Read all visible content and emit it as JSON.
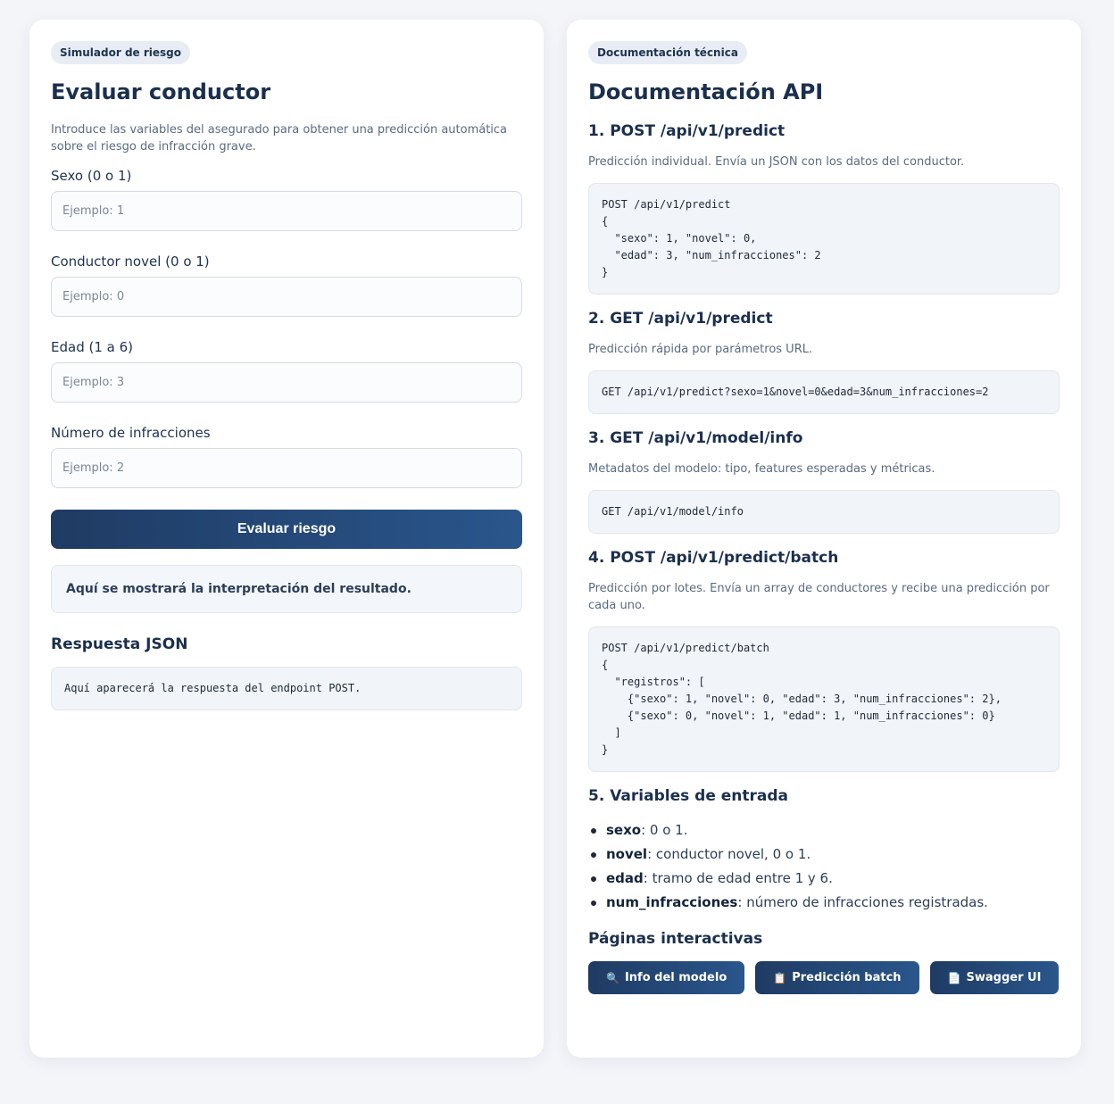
{
  "left": {
    "badge": "Simulador de riesgo",
    "title": "Evaluar conductor",
    "intro": "Introduce las variables del asegurado para obtener una predicción automática sobre el riesgo de infracción grave.",
    "fields": [
      {
        "label": "Sexo (0 o 1)",
        "placeholder": "Ejemplo: 1",
        "value": ""
      },
      {
        "label": "Conductor novel (0 o 1)",
        "placeholder": "Ejemplo: 0",
        "value": ""
      },
      {
        "label": "Edad (1 a 6)",
        "placeholder": "Ejemplo: 3",
        "value": ""
      },
      {
        "label": "Número de infracciones",
        "placeholder": "Ejemplo: 2",
        "value": ""
      }
    ],
    "submit_label": "Evaluar riesgo",
    "result_text": "Aquí se mostrará la interpretación del resultado.",
    "json_title": "Respuesta JSON",
    "json_placeholder": "Aquí aparecerá la respuesta del endpoint POST."
  },
  "right": {
    "badge": "Documentación técnica",
    "title": "Documentación API",
    "sections": [
      {
        "title": "1. POST /api/v1/predict",
        "desc": "Predicción individual. Envía un JSON con los datos del conductor.",
        "code": "POST /api/v1/predict\n{\n  \"sexo\": 1, \"novel\": 0,\n  \"edad\": 3, \"num_infracciones\": 2\n}"
      },
      {
        "title": "2. GET /api/v1/predict",
        "desc": "Predicción rápida por parámetros URL.",
        "code": "GET /api/v1/predict?sexo=1&novel=0&edad=3&num_infracciones=2"
      },
      {
        "title": "3. GET /api/v1/model/info",
        "desc": "Metadatos del modelo: tipo, features esperadas y métricas.",
        "code": "GET /api/v1/model/info"
      },
      {
        "title": "4. POST /api/v1/predict/batch",
        "desc": "Predicción por lotes. Envía un array de conductores y recibe una predicción por cada uno.",
        "code": "POST /api/v1/predict/batch\n{\n  \"registros\": [\n    {\"sexo\": 1, \"novel\": 0, \"edad\": 3, \"num_infracciones\": 2},\n    {\"sexo\": 0, \"novel\": 1, \"edad\": 1, \"num_infracciones\": 0}\n  ]\n}"
      }
    ],
    "vars_title": "5. Variables de entrada",
    "vars": [
      {
        "name": "sexo",
        "desc": ": 0 o 1."
      },
      {
        "name": "novel",
        "desc": ": conductor novel, 0 o 1."
      },
      {
        "name": "edad",
        "desc": ": tramo de edad entre 1 y 6."
      },
      {
        "name": "num_infracciones",
        "desc": ": número de infracciones registradas."
      }
    ],
    "pages_title": "Páginas interactivas",
    "pages": [
      {
        "icon": "magnifier-icon",
        "glyph": "🔍",
        "label": "Info del modelo"
      },
      {
        "icon": "clipboard-icon",
        "glyph": "📋",
        "label": "Predicción batch"
      },
      {
        "icon": "document-icon",
        "glyph": "📄",
        "label": "Swagger UI"
      }
    ]
  },
  "colors": {
    "background": "#f3f5f9",
    "primary": "#1f3b63",
    "primary_end": "#2a568c",
    "text": "#1e3350"
  }
}
